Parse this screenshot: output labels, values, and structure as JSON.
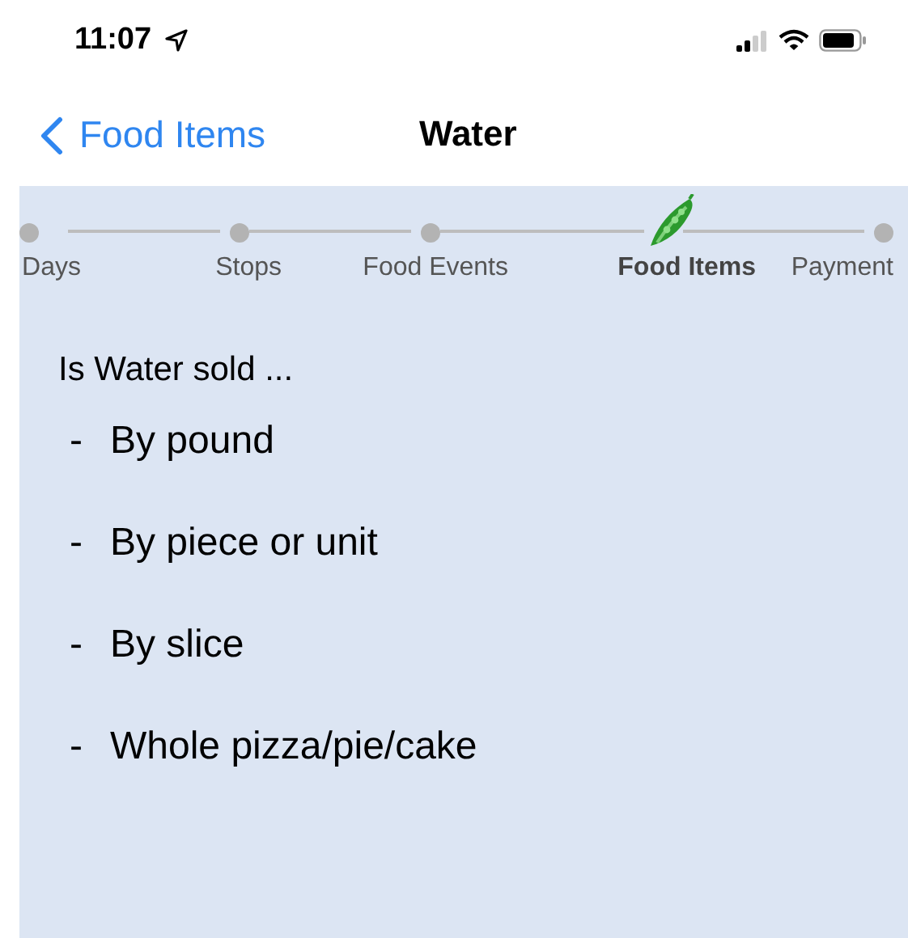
{
  "status_bar": {
    "time": "11:07"
  },
  "nav": {
    "back": "Food Items",
    "title": "Water"
  },
  "steps": [
    {
      "label": "Days",
      "selected": false
    },
    {
      "label": "Stops",
      "selected": false
    },
    {
      "label": "Food Events",
      "selected": false
    },
    {
      "label": "Food Items",
      "selected": true
    },
    {
      "label": "Payment",
      "selected": false
    }
  ],
  "question": "Is Water sold ...",
  "options": [
    {
      "marker": "-",
      "label": "By pound"
    },
    {
      "marker": "-",
      "label": "By piece or unit"
    },
    {
      "marker": "-",
      "label": "By slice"
    },
    {
      "marker": "-",
      "label": "Whole pizza/pie/cake"
    }
  ]
}
